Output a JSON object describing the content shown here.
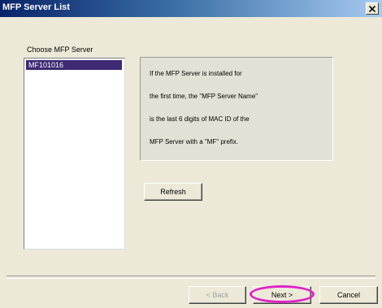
{
  "window": {
    "title": "MFP Server List",
    "close_glyph": "×"
  },
  "server_group": {
    "label": "Choose MFP Server",
    "items": [
      "MF101016"
    ]
  },
  "info": {
    "lines": [
      "If the MFP Server is installed for",
      "the first time, the \"MFP Server Name\"",
      "is the last 6 digits of MAC ID of the",
      "MFP Server with a \"MF\" prefix."
    ]
  },
  "buttons": {
    "refresh": "Refresh",
    "back": "< Back",
    "next": "Next >",
    "cancel": "Cancel"
  },
  "colors": {
    "selection": "#3d2a72",
    "annotation_ring": "#e020c8"
  }
}
